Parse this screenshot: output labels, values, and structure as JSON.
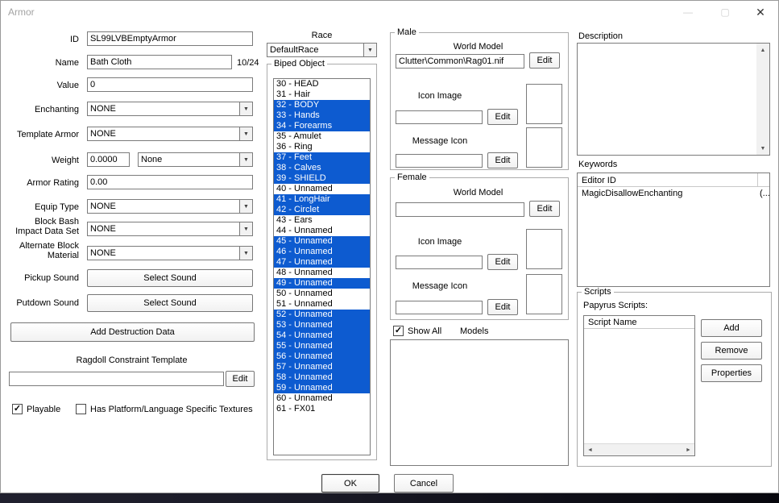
{
  "window": {
    "title": "Armor"
  },
  "icons": {
    "minimize": "—",
    "maximize": "▢",
    "close": "✕",
    "combo_arrow": "▼",
    "scroll_up": "▲",
    "scroll_down": "▼",
    "scroll_left": "◄",
    "scroll_right": "►",
    "check": "✓"
  },
  "colors": {
    "selection_blue": "#0d5bd0"
  },
  "left": {
    "id": {
      "label": "ID",
      "value": "SL99LVBEmptyArmor"
    },
    "name": {
      "label": "Name",
      "value": "Bath Cloth",
      "counter": "10/24"
    },
    "value": {
      "label": "Value",
      "value": "0"
    },
    "enchanting": {
      "label": "Enchanting",
      "value": "NONE"
    },
    "template_armor": {
      "label": "Template Armor",
      "value": "NONE"
    },
    "weight": {
      "label": "Weight",
      "value": "0.0000",
      "unit": "None"
    },
    "armor_rating": {
      "label": "Armor Rating",
      "value": "0.00"
    },
    "equip_type": {
      "label": "Equip Type",
      "value": "NONE"
    },
    "block_bash": {
      "label_line1": "Block Bash",
      "label_line2": "Impact Data Set",
      "value": "NONE"
    },
    "alt_block": {
      "label_line1": "Alternate Block",
      "label_line2": "Material",
      "value": "NONE"
    },
    "pickup_sound": {
      "label": "Pickup Sound",
      "button": "Select Sound"
    },
    "putdown_sound": {
      "label": "Putdown Sound",
      "button": "Select Sound"
    },
    "add_destruction_button": "Add Destruction Data",
    "ragdoll": {
      "label": "Ragdoll Constraint Template",
      "value": "",
      "edit": "Edit"
    },
    "playable": {
      "label": "Playable",
      "checked": true
    },
    "platform_textures": {
      "label": "Has Platform/Language Specific Textures",
      "checked": false
    }
  },
  "race": {
    "label": "Race",
    "value": "DefaultRace"
  },
  "biped": {
    "group_label": "Biped Object",
    "items": [
      {
        "label": "30 - HEAD",
        "selected": false
      },
      {
        "label": "31 - Hair",
        "selected": false
      },
      {
        "label": "32 - BODY",
        "selected": true
      },
      {
        "label": "33 - Hands",
        "selected": true
      },
      {
        "label": "34 - Forearms",
        "selected": true
      },
      {
        "label": "35 - Amulet",
        "selected": false
      },
      {
        "label": "36 - Ring",
        "selected": false
      },
      {
        "label": "37 - Feet",
        "selected": true
      },
      {
        "label": "38 - Calves",
        "selected": true
      },
      {
        "label": "39 - SHIELD",
        "selected": true
      },
      {
        "label": "40 - Unnamed",
        "selected": false
      },
      {
        "label": "41 - LongHair",
        "selected": true
      },
      {
        "label": "42 - Circlet",
        "selected": true
      },
      {
        "label": "43 - Ears",
        "selected": false
      },
      {
        "label": "44 - Unnamed",
        "selected": false
      },
      {
        "label": "45 - Unnamed",
        "selected": true
      },
      {
        "label": "46 - Unnamed",
        "selected": true
      },
      {
        "label": "47 - Unnamed",
        "selected": true
      },
      {
        "label": "48 - Unnamed",
        "selected": false
      },
      {
        "label": "49 - Unnamed",
        "selected": true
      },
      {
        "label": "50 - Unnamed",
        "selected": false
      },
      {
        "label": "51 - Unnamed",
        "selected": false
      },
      {
        "label": "52 - Unnamed",
        "selected": true
      },
      {
        "label": "53 - Unnamed",
        "selected": true
      },
      {
        "label": "54 - Unnamed",
        "selected": true
      },
      {
        "label": "55 - Unnamed",
        "selected": true
      },
      {
        "label": "56 - Unnamed",
        "selected": true
      },
      {
        "label": "57 - Unnamed",
        "selected": true
      },
      {
        "label": "58 - Unnamed",
        "selected": true
      },
      {
        "label": "59 - Unnamed",
        "selected": true
      },
      {
        "label": "60 - Unnamed",
        "selected": false
      },
      {
        "label": "61 - FX01",
        "selected": false
      }
    ]
  },
  "male": {
    "group_label": "Male",
    "world_model": {
      "label": "World Model",
      "value": "Clutter\\Common\\Rag01.nif",
      "edit": "Edit"
    },
    "icon_image": {
      "label": "Icon Image",
      "value": "",
      "edit": "Edit"
    },
    "message_icon": {
      "label": "Message Icon",
      "value": "",
      "edit": "Edit"
    }
  },
  "female": {
    "group_label": "Female",
    "world_model": {
      "label": "World Model",
      "value": "",
      "edit": "Edit"
    },
    "icon_image": {
      "label": "Icon Image",
      "value": "",
      "edit": "Edit"
    },
    "message_icon": {
      "label": "Message Icon",
      "value": "",
      "edit": "Edit"
    }
  },
  "models": {
    "show_all_label": "Show All",
    "show_all_checked": true,
    "label": "Models"
  },
  "description": {
    "label": "Description",
    "value": ""
  },
  "keywords": {
    "label": "Keywords",
    "column1": "Editor ID",
    "rows": [
      {
        "editor_id": "MagicDisallowEnchanting",
        "extra": "(..."
      }
    ]
  },
  "scripts": {
    "group_label": "Scripts",
    "papyrus_label": "Papyrus Scripts:",
    "column": "Script Name",
    "add": "Add",
    "remove": "Remove",
    "properties": "Properties"
  },
  "footer": {
    "ok": "OK",
    "cancel": "Cancel"
  }
}
